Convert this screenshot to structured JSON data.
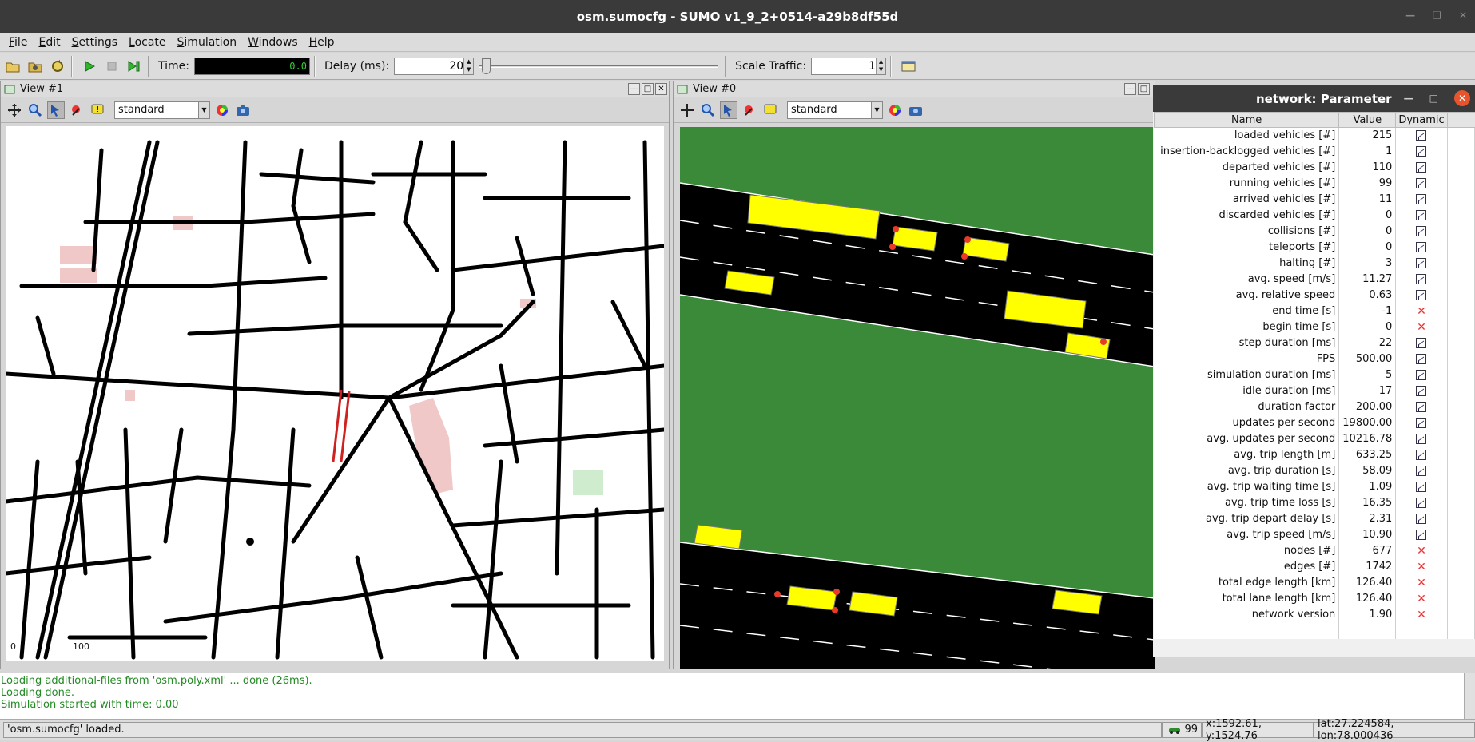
{
  "window": {
    "title": "osm.sumocfg - SUMO v1_9_2+0514-a29b8df55d"
  },
  "menu": [
    {
      "label": "File",
      "u": "F",
      "rest": "ile"
    },
    {
      "label": "Edit",
      "u": "E",
      "rest": "dit"
    },
    {
      "label": "Settings",
      "u": "S",
      "rest": "ettings"
    },
    {
      "label": "Locate",
      "u": "L",
      "rest": "ocate"
    },
    {
      "label": "Simulation",
      "u": "S",
      "rest": "imulation"
    },
    {
      "label": "Windows",
      "u": "W",
      "rest": "indows"
    },
    {
      "label": "Help",
      "u": "H",
      "rest": "elp"
    }
  ],
  "toolbar": {
    "time_label": "Time:",
    "time_value": "0.0",
    "delay_label": "Delay (ms):",
    "delay_value": "20",
    "scale_label": "Scale Traffic:",
    "scale_value": "1"
  },
  "view1": {
    "title": "View #1",
    "scheme": "standard",
    "scale_start": "0",
    "scale_end": "100"
  },
  "view0": {
    "title": "View #0",
    "scheme": "standard"
  },
  "params": {
    "title": "network: Parameter",
    "col_name": "Name",
    "col_value": "Value",
    "col_dynamic": "Dynamic",
    "rows": [
      {
        "name": "loaded vehicles [#]",
        "value": "215",
        "dyn": true
      },
      {
        "name": "insertion-backlogged vehicles [#]",
        "value": "1",
        "dyn": true
      },
      {
        "name": "departed vehicles [#]",
        "value": "110",
        "dyn": true
      },
      {
        "name": "running vehicles [#]",
        "value": "99",
        "dyn": true
      },
      {
        "name": "arrived vehicles [#]",
        "value": "11",
        "dyn": true
      },
      {
        "name": "discarded vehicles [#]",
        "value": "0",
        "dyn": true
      },
      {
        "name": "collisions [#]",
        "value": "0",
        "dyn": true
      },
      {
        "name": "teleports [#]",
        "value": "0",
        "dyn": true
      },
      {
        "name": "halting [#]",
        "value": "3",
        "dyn": true
      },
      {
        "name": "avg. speed [m/s]",
        "value": "11.27",
        "dyn": true
      },
      {
        "name": "avg. relative speed",
        "value": "0.63",
        "dyn": true
      },
      {
        "name": "end time [s]",
        "value": "-1",
        "dyn": false
      },
      {
        "name": "begin time [s]",
        "value": "0",
        "dyn": false
      },
      {
        "name": "step duration [ms]",
        "value": "22",
        "dyn": true
      },
      {
        "name": "FPS",
        "value": "500.00",
        "dyn": true
      },
      {
        "name": "simulation duration [ms]",
        "value": "5",
        "dyn": true
      },
      {
        "name": "idle duration [ms]",
        "value": "17",
        "dyn": true
      },
      {
        "name": "duration factor",
        "value": "200.00",
        "dyn": true
      },
      {
        "name": "updates per second",
        "value": "19800.00",
        "dyn": true
      },
      {
        "name": "avg. updates per second",
        "value": "10216.78",
        "dyn": true
      },
      {
        "name": "avg. trip length [m]",
        "value": "633.25",
        "dyn": true
      },
      {
        "name": "avg. trip duration [s]",
        "value": "58.09",
        "dyn": true
      },
      {
        "name": "avg. trip waiting time [s]",
        "value": "1.09",
        "dyn": true
      },
      {
        "name": "avg. trip time loss [s]",
        "value": "16.35",
        "dyn": true
      },
      {
        "name": "avg. trip depart delay [s]",
        "value": "2.31",
        "dyn": true
      },
      {
        "name": "avg. trip speed [m/s]",
        "value": "10.90",
        "dyn": true
      },
      {
        "name": "nodes [#]",
        "value": "677",
        "dyn": false
      },
      {
        "name": "edges [#]",
        "value": "1742",
        "dyn": false
      },
      {
        "name": "total edge length [km]",
        "value": "126.40",
        "dyn": false
      },
      {
        "name": "total lane length [km]",
        "value": "126.40",
        "dyn": false
      },
      {
        "name": "network version",
        "value": "1.90",
        "dyn": false
      }
    ]
  },
  "messages": [
    "Loading additional-files from 'osm.poly.xml' ... done (26ms).",
    "Loading done.",
    "Simulation started with time: 0.00"
  ],
  "status": {
    "text": "'osm.sumocfg' loaded.",
    "vehicle_count": "99",
    "coords": "x:1592.61, y:1524.76",
    "geo": "lat:27.224584, lon:78.000436"
  },
  "colors": {
    "grass": "#3a8a3a",
    "road": "#000000",
    "car": "#ffff00",
    "log_green": "#228b22"
  }
}
